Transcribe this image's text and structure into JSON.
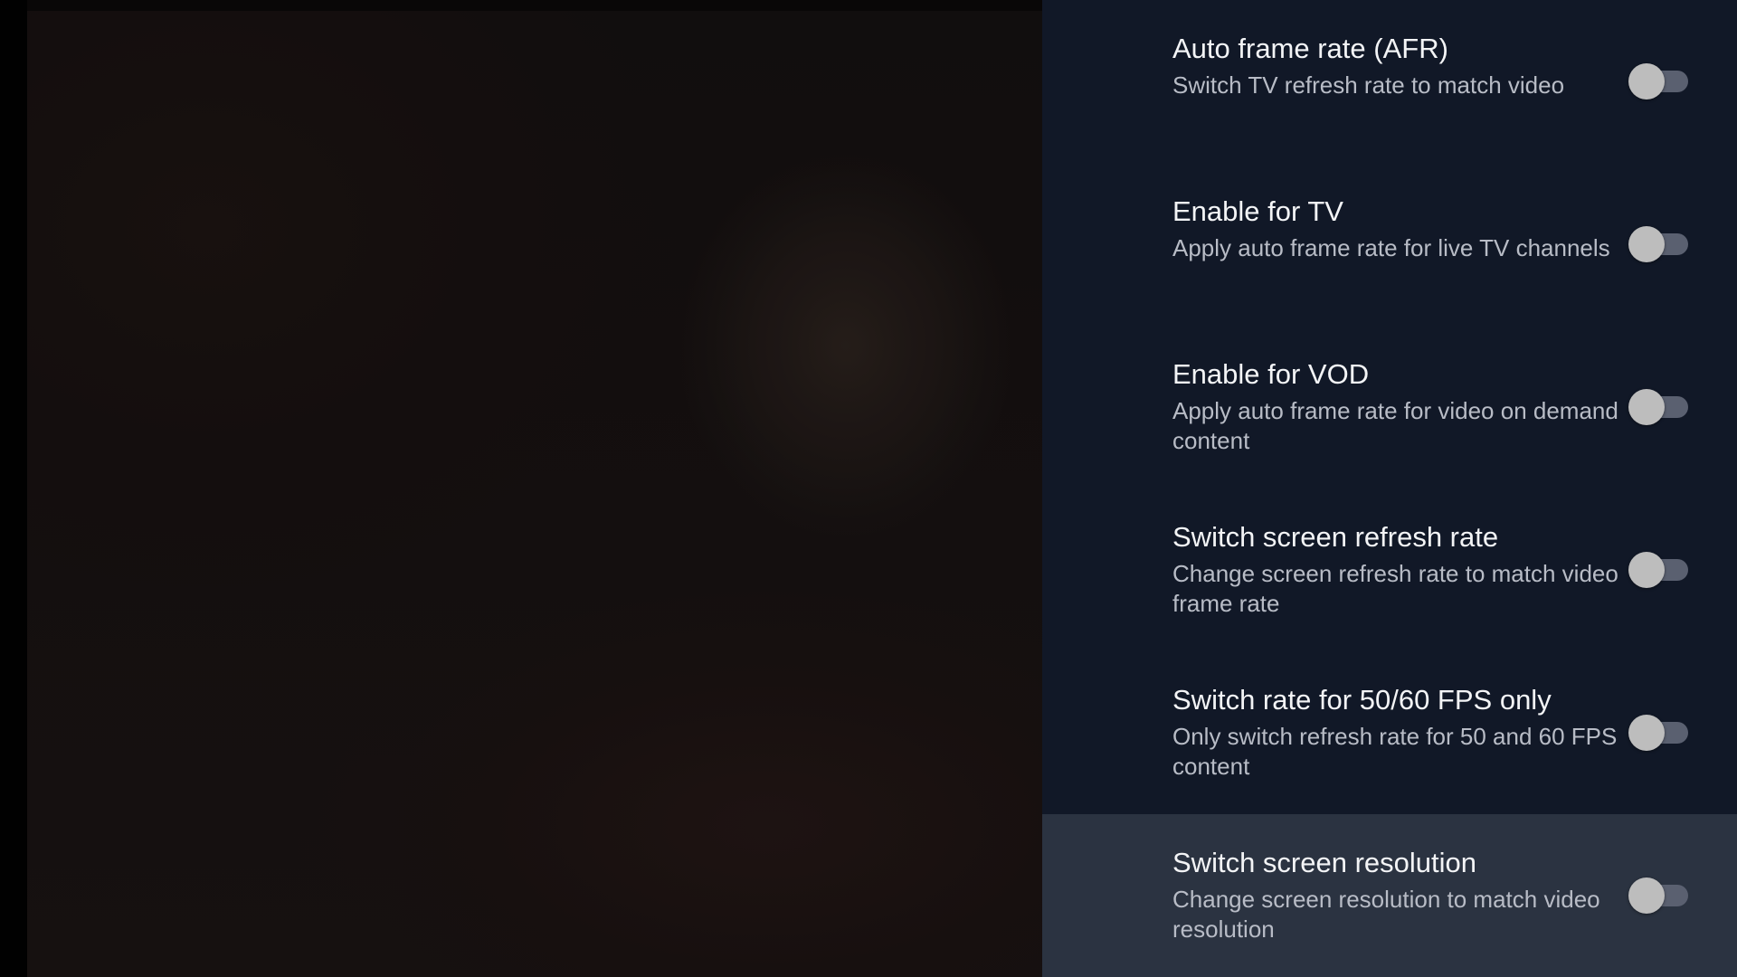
{
  "settings": {
    "items": [
      {
        "title": "Auto frame rate (AFR)",
        "description": "Switch TV refresh rate to match video",
        "enabled": false
      },
      {
        "title": "Enable for TV",
        "description": "Apply auto frame rate for live TV channels",
        "enabled": false
      },
      {
        "title": "Enable for VOD",
        "description": "Apply auto frame rate for video on demand content",
        "enabled": false
      },
      {
        "title": "Switch screen refresh rate",
        "description": "Change screen refresh rate to match video frame rate",
        "enabled": false
      },
      {
        "title": "Switch rate for 50/60 FPS only",
        "description": "Only switch refresh rate for 50 and 60 FPS content",
        "enabled": false
      },
      {
        "title": "Switch screen resolution",
        "description": "Change screen resolution to match video resolution",
        "enabled": false,
        "focused": true
      }
    ]
  },
  "colors": {
    "panel_background": "#111827",
    "focused_row": "#2b3341",
    "toggle_thumb_off": "#bdbdbd",
    "toggle_track_off": "#5a6070"
  }
}
